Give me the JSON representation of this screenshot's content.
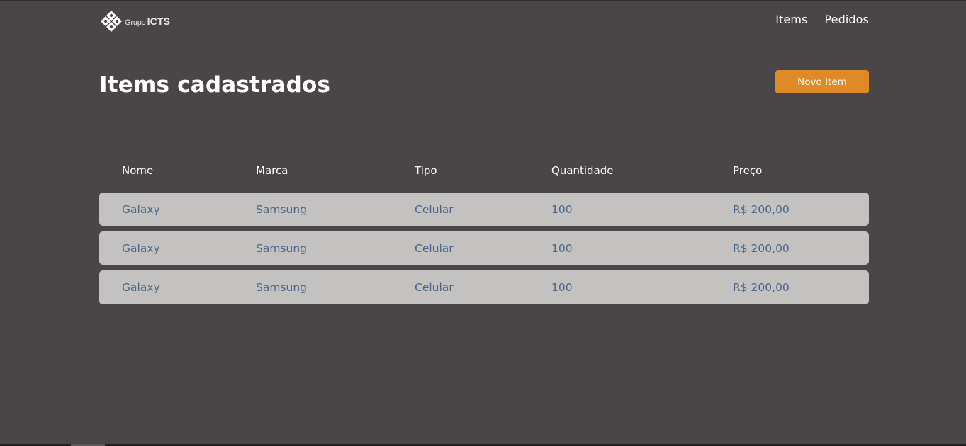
{
  "navbar": {
    "logo": {
      "word1": "Grupo",
      "word2": "ICTS",
      "icon": "diamond-logo-icon"
    },
    "links": [
      {
        "label": "Items"
      },
      {
        "label": "Pedidos"
      }
    ]
  },
  "main": {
    "title": "Items cadastrados",
    "new_item_label": "Novo Item"
  },
  "table": {
    "headers": [
      "Nome",
      "Marca",
      "Tipo",
      "Quantidade",
      "Preço"
    ],
    "rows": [
      [
        "Galaxy",
        "Samsung",
        "Celular",
        "100",
        "R$ 200,00"
      ],
      [
        "Galaxy",
        "Samsung",
        "Celular",
        "100",
        "R$ 200,00"
      ],
      [
        "Galaxy",
        "Samsung",
        "Celular",
        "100",
        "R$ 200,00"
      ]
    ]
  },
  "colors": {
    "background": "#4a4546",
    "accent": "#e08a27",
    "row_background": "#c3c2c0",
    "row_text": "#49658a"
  }
}
